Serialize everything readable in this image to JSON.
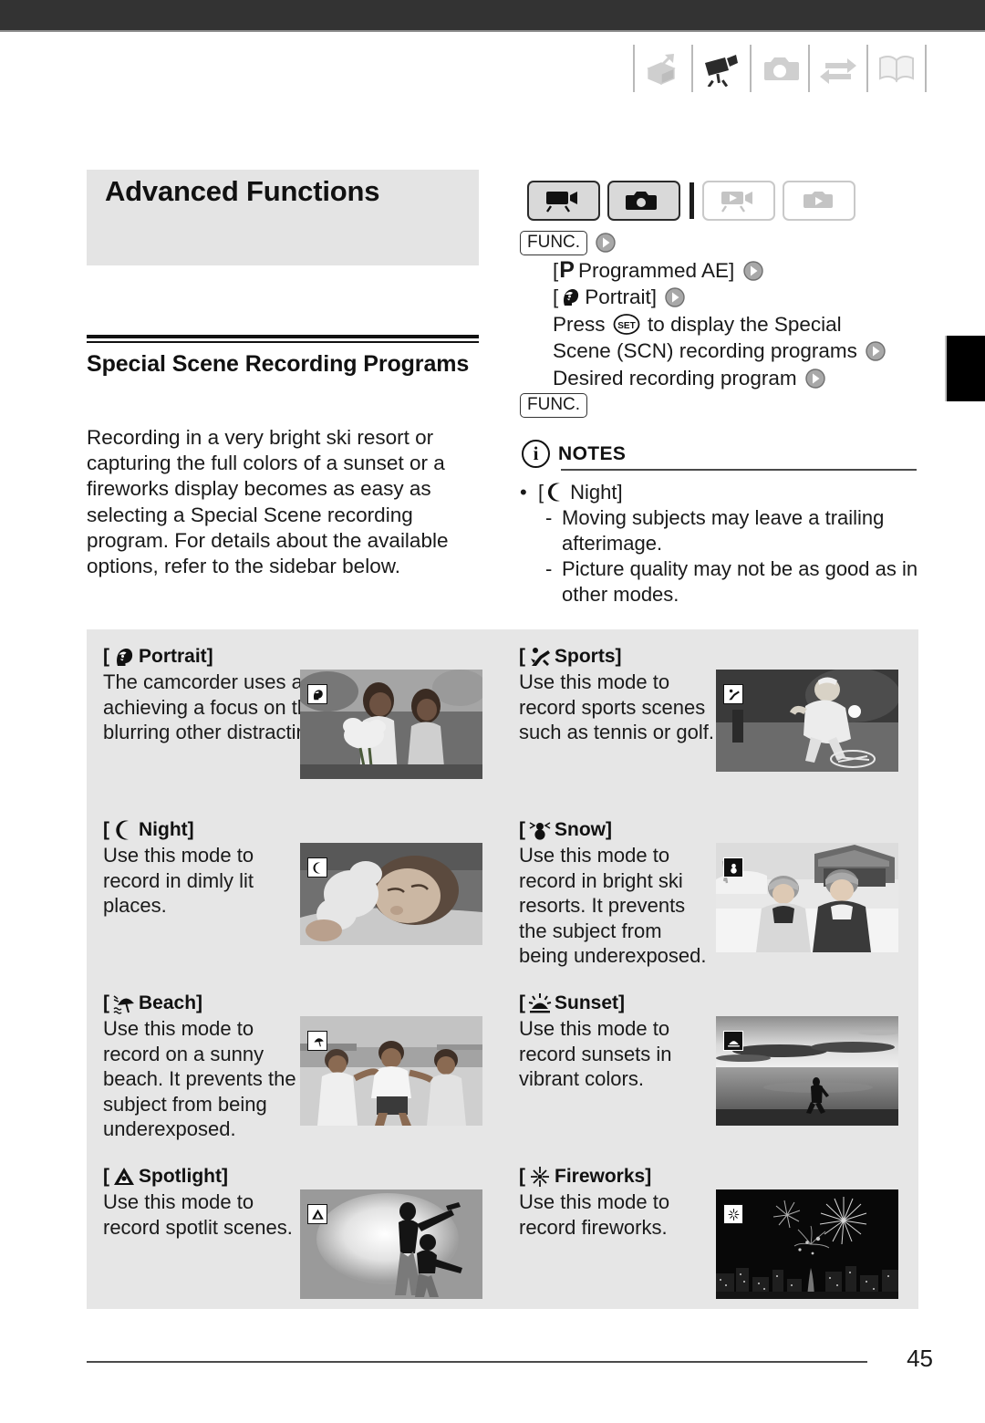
{
  "header": {
    "icons": [
      {
        "name": "unpacking-icon",
        "state": "inactive"
      },
      {
        "name": "camcorder-icon",
        "state": "active"
      },
      {
        "name": "photo-camera-icon",
        "state": "inactive"
      },
      {
        "name": "transfer-arrows-icon",
        "state": "inactive"
      },
      {
        "name": "open-book-icon",
        "state": "inactive"
      }
    ]
  },
  "chapter": {
    "title": "Advanced Functions"
  },
  "section": {
    "title": "Special Scene Recording Programs",
    "intro": "Recording in a very bright ski resort or capturing the full colors of a sunset or a fireworks display becomes as easy as selecting a Special Scene recording program. For details about the available options, refer to the sidebar below."
  },
  "modes": [
    {
      "label": "camcorder-record",
      "state": "active"
    },
    {
      "label": "photo-record",
      "state": "active"
    },
    {
      "label": "camcorder-playback",
      "state": "inactive"
    },
    {
      "label": "photo-playback",
      "state": "inactive"
    }
  ],
  "procedure": {
    "func_label": "FUNC.",
    "line_programmed_ae": "Programmed AE]",
    "line_programmed_ae_open": "[",
    "line_portrait_open": "[",
    "line_portrait": "Portrait]",
    "line_press_1": "Press",
    "line_press_2": "to display the Special",
    "line_scene": "Scene (SCN) recording programs",
    "line_desired": "Desired recording program",
    "set_label": "SET",
    "p_glyph": "P",
    "func_label_end": "FUNC."
  },
  "notes": {
    "icon": "info-icon",
    "i_glyph": "i",
    "label": "NOTES",
    "bullet_dot": "•",
    "dash": "-",
    "item_open": "[",
    "item_title": "Night]",
    "sub_items": [
      "Moving subjects may leave a trailing afterimage.",
      "Picture quality may not be as good as in other modes."
    ]
  },
  "scenes": [
    {
      "bracket_open": "[",
      "title": "Portrait]",
      "icon": "portrait-head-icon",
      "body": "The camcorder uses a large aperture, achieving a focus on the subject while blurring other distracting details.",
      "photo": "portrait-children-flowers-photo"
    },
    {
      "bracket_open": "[",
      "title": "Sports]",
      "icon": "sports-runner-icon",
      "body": "Use this mode to record sports scenes such as tennis or golf.",
      "photo": "sports-tennis-player-photo"
    },
    {
      "bracket_open": "[",
      "title": "Night]",
      "icon": "night-moon-icon",
      "body": "Use this mode to record in dimly lit places.",
      "photo": "night-sleeping-child-photo"
    },
    {
      "bracket_open": "[",
      "title": "Snow]",
      "icon": "snow-snowman-icon",
      "body": "Use this mode to record in bright ski resorts. It prevents the subject from being underexposed.",
      "photo": "snow-two-children-photo"
    },
    {
      "bracket_open": "[",
      "title": "Beach]",
      "icon": "beach-parasol-icon",
      "body": "Use this mode to record on a sunny beach. It prevents the subject from being underexposed.",
      "photo": "beach-three-people-photo"
    },
    {
      "bracket_open": "[",
      "title": "Sunset]",
      "icon": "sunset-sun-icon",
      "body": "Use this mode to record sunsets in vibrant colors.",
      "photo": "sunset-shoreline-walker-photo"
    },
    {
      "bracket_open": "[",
      "title": "Spotlight]",
      "icon": "spotlight-cone-icon",
      "body": "Use this mode to record spotlit scenes.",
      "photo": "spotlight-dancers-photo"
    },
    {
      "bracket_open": "[",
      "title": "Fireworks]",
      "icon": "fireworks-burst-icon",
      "body": "Use this mode to record fireworks.",
      "photo": "fireworks-city-skyline-photo"
    }
  ],
  "footer": {
    "page_number": "45"
  },
  "colors": {
    "topbar": "#333333",
    "banner_gray": "#e4e4e4",
    "panel_gray": "#e6e6e6",
    "tab_black": "#000000",
    "text": "#1a1a1a"
  }
}
